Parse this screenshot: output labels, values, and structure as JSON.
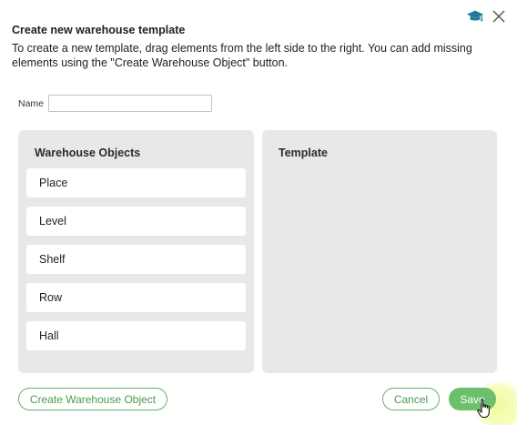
{
  "dialog": {
    "title": "Create new warehouse template",
    "description": "To create a new template, drag elements from the left side to the right. You can add missing elements using the \"Create Warehouse Object\" button."
  },
  "icons": {
    "help": "graduation-cap-icon",
    "close": "close-icon"
  },
  "form": {
    "name_label": "Name",
    "name_value": "",
    "name_placeholder": ""
  },
  "objects_panel": {
    "title": "Warehouse Objects",
    "items": [
      {
        "label": "Place"
      },
      {
        "label": "Level"
      },
      {
        "label": "Shelf"
      },
      {
        "label": "Row"
      },
      {
        "label": "Hall"
      }
    ]
  },
  "template_panel": {
    "title": "Template"
  },
  "buttons": {
    "create_object": "Create Warehouse Object",
    "cancel": "Cancel",
    "save": "Save"
  },
  "colors": {
    "accent": "#6cc06c",
    "accent_text": "#4a9a4a",
    "panel_bg": "#e8e8e8",
    "help_icon": "#1f7a9a"
  }
}
